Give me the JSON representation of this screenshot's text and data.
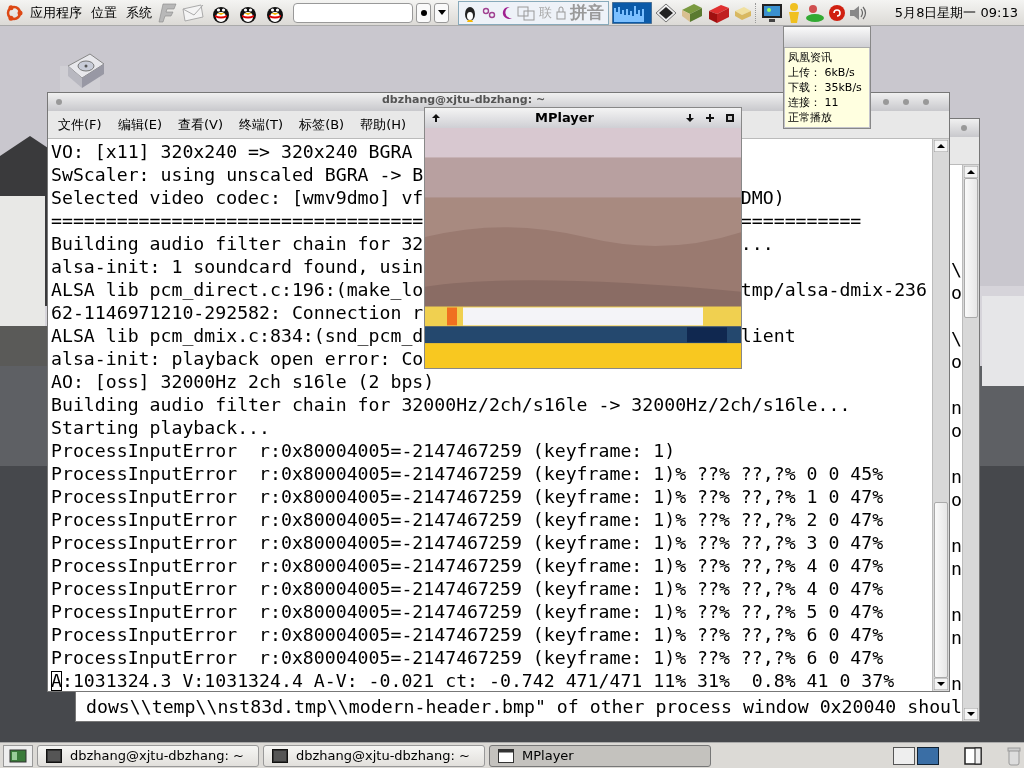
{
  "top_panel": {
    "menus": [
      "应用程序",
      "位置",
      "系统"
    ],
    "ime_labels": [
      "联",
      "拼音"
    ],
    "clock": "5月8日星期一 09:13"
  },
  "tooltip": {
    "title": "凤凰资讯",
    "lines": [
      "上传： 6kB/s",
      "下载： 35kB/s",
      "连接： 11",
      "正常播放"
    ]
  },
  "back_terminal": {
    "edge_column": [
      {
        "upper": "\\",
        "lower": "o"
      },
      {
        "upper": "\\",
        "lower": "o"
      },
      {
        "upper": "n",
        "lower": "o"
      },
      {
        "upper": "n",
        "lower": "o"
      },
      {
        "upper": "n",
        "lower": "n"
      },
      {
        "upper": "n",
        "lower": "n"
      },
      {
        "upper": "n"
      }
    ],
    "last_line": "dows\\\\temp\\\\nst83d.tmp\\\\modern-header.bmp\" of other process window 0x20040 shoul"
  },
  "terminal": {
    "title": "dbzhang@xjtu-dbzhang: ~",
    "menu": [
      "文件(F)",
      "编辑(E)",
      "查看(V)",
      "终端(T)",
      "标签(B)",
      "帮助(H)"
    ],
    "lines": [
      {
        "text": "VO: [x11] 320x240 => 320x240 BGRA"
      },
      {
        "text": "SwScaler: using unscaled BGRA -> B"
      },
      {
        "text": "Selected video codec: [wmv9dmo] vf",
        "after_overlap": "DMO)"
      },
      {
        "text": "==================================",
        "after_overlap": "==========="
      },
      {
        "text": "Building audio filter chain for 32",
        "after_overlap": "..."
      },
      {
        "text": "alsa-init: 1 soundcard found, usin"
      },
      {
        "text": "ALSA lib pcm_direct.c:196:(make_lo",
        "after_overlap": "tmp/alsa-dmix-236"
      },
      {
        "text": "62-1146971210-292582: Connection r"
      },
      {
        "text": "ALSA lib pcm_dmix.c:834:(snd_pcm_d",
        "after_overlap": "lient"
      },
      {
        "text": "alsa-init: playback open error: Co"
      },
      {
        "text": "AO: [oss] 32000Hz 2ch s16le (2 bps)"
      },
      {
        "text": "Building audio filter chain for 32000Hz/2ch/s16le -> 32000Hz/2ch/s16le..."
      },
      {
        "text": "Starting playback..."
      },
      {
        "text": "ProcessInputError  r:0x80004005=-2147467259 (keyframe: 1)"
      },
      {
        "text": "ProcessInputError  r:0x80004005=-2147467259 (keyframe: 1)% ??% ??,?% 0 0 45%"
      },
      {
        "text": "ProcessInputError  r:0x80004005=-2147467259 (keyframe: 1)% ??% ??,?% 1 0 47%"
      },
      {
        "text": "ProcessInputError  r:0x80004005=-2147467259 (keyframe: 1)% ??% ??,?% 2 0 47%"
      },
      {
        "text": "ProcessInputError  r:0x80004005=-2147467259 (keyframe: 1)% ??% ??,?% 3 0 47%"
      },
      {
        "text": "ProcessInputError  r:0x80004005=-2147467259 (keyframe: 1)% ??% ??,?% 4 0 47%"
      },
      {
        "text": "ProcessInputError  r:0x80004005=-2147467259 (keyframe: 1)% ??% ??,?% 4 0 47%"
      },
      {
        "text": "ProcessInputError  r:0x80004005=-2147467259 (keyframe: 1)% ??% ??,?% 5 0 47%"
      },
      {
        "text": "ProcessInputError  r:0x80004005=-2147467259 (keyframe: 1)% ??% ??,?% 6 0 47%"
      },
      {
        "text": "ProcessInputError  r:0x80004005=-2147467259 (keyframe: 1)% ??% ??,?% 6 0 47%"
      },
      {
        "text": "A:1031324.3 V:1031324.4 A-V: -0.021 ct: -0.742 471/471 11% 31%  0.8% 41 0 37%"
      }
    ]
  },
  "mplayer": {
    "title": "MPlayer"
  },
  "taskbar": {
    "tasks": [
      {
        "kind": "terminal",
        "label": "dbzhang@xjtu-dbzhang: ~",
        "selected": false
      },
      {
        "kind": "terminal",
        "label": "dbzhang@xjtu-dbzhang: ~",
        "selected": false
      },
      {
        "kind": "window",
        "label": "MPlayer",
        "selected": true
      }
    ],
    "workspaces": [
      {
        "selected": false
      },
      {
        "selected": true
      }
    ]
  }
}
